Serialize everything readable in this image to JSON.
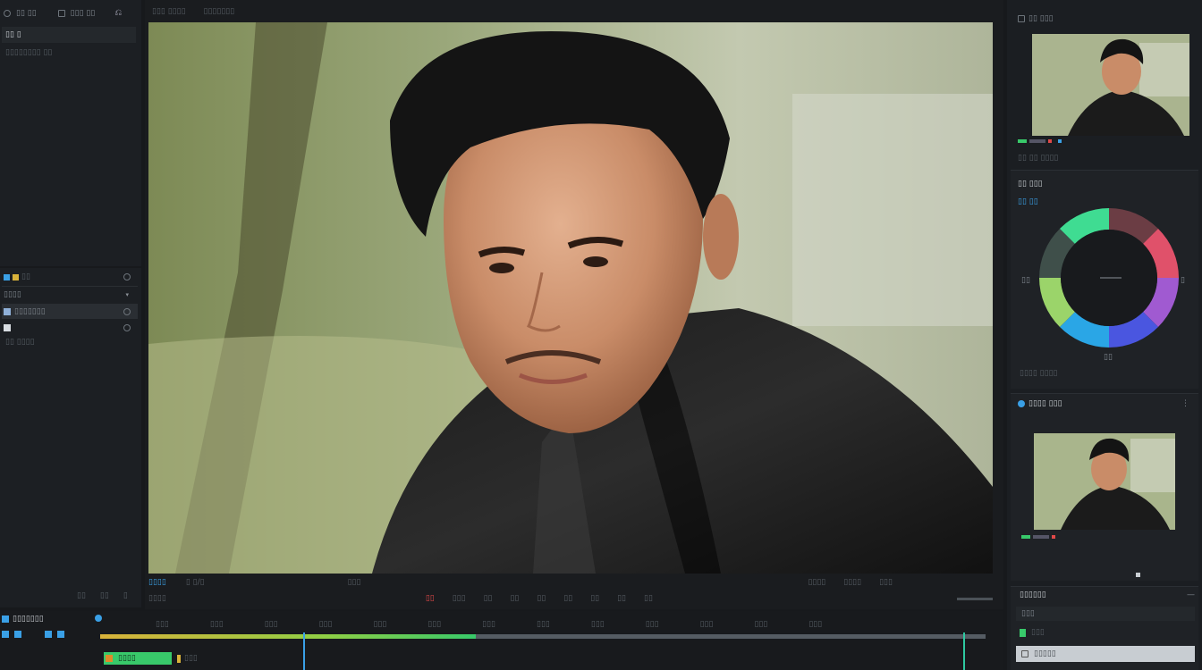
{
  "colors": {
    "accent_blue": "#3aa0e6",
    "accent_green": "#38c96a",
    "accent_red": "#e04848",
    "accent_yellow": "#d9b23a",
    "bg": "#17191c"
  },
  "left_panel": {
    "toolbar": {
      "item1_label": "▯▯ ▯▯",
      "item2_label": "▯▯▯ ▯▯",
      "back_icon": "back-icon"
    },
    "header": "▯▯ ▯",
    "subheader": "▯▯▯▯▯▯▯▯ ▯▯",
    "section2_icons": "▯▯",
    "section2_title": "▯▯▯▯",
    "list_items": [
      {
        "label": "▯▯▯▯▯▯▯"
      },
      {
        "label": ""
      },
      {
        "label": "▯▯ ▯▯▯▯"
      }
    ]
  },
  "viewer": {
    "top_labels": [
      "▯▯▯ ▯▯▯▯",
      "▯▯▯▯▯▯▯"
    ],
    "bottom_left": "▯▯▯▯",
    "bottom_mid": "▯ ▯/▯",
    "bottom_center": "▯▯▯",
    "bottom_right": [
      "▯▯▯▯",
      "▯▯▯▯",
      "▯▯▯"
    ],
    "transport": [
      "▯▯",
      "▯▯▯",
      "▯▯",
      "▯▯",
      "▯▯",
      "▯▯",
      "▯▯",
      "▯▯",
      "▯▯"
    ],
    "transport_bar_left": "▯▯▯▯"
  },
  "right_panel": {
    "top_label": "▯▯ ▯▯▯",
    "thumb1_caption": "▯▯ ▯▯ ▯▯▯▯",
    "color_section_title": "▯▯ ▯▯▯",
    "color_section_sub": "▯▯ ▯▯",
    "wheel_left_label": "▯▯",
    "wheel_right_label": "▯",
    "wheel_bottom_label": "▯▯",
    "color_footer": "▯▯▯▯ ▯▯▯▯",
    "section3_title": "▯▯▯▯ ▯▯▯",
    "section4_title": "▯▯▯▯▯▯",
    "section4_field": "▯▯▯",
    "section4_items": [
      "▯▯▯",
      "▯▯▯▯▯"
    ]
  },
  "timeline": {
    "title": "▯▯▯▯▯▯▯",
    "ticks": [
      "▯▯▯",
      "▯▯▯",
      "▯▯▯",
      "▯▯▯",
      "▯▯▯",
      "▯▯▯",
      "▯▯▯",
      "▯▯▯",
      "▯▯▯",
      "▯▯▯",
      "▯▯▯",
      "▯▯▯",
      "▯▯▯",
      "▯▯▯"
    ],
    "clip_label": "▯▯▯▯",
    "track_label": "▯▯▯"
  }
}
